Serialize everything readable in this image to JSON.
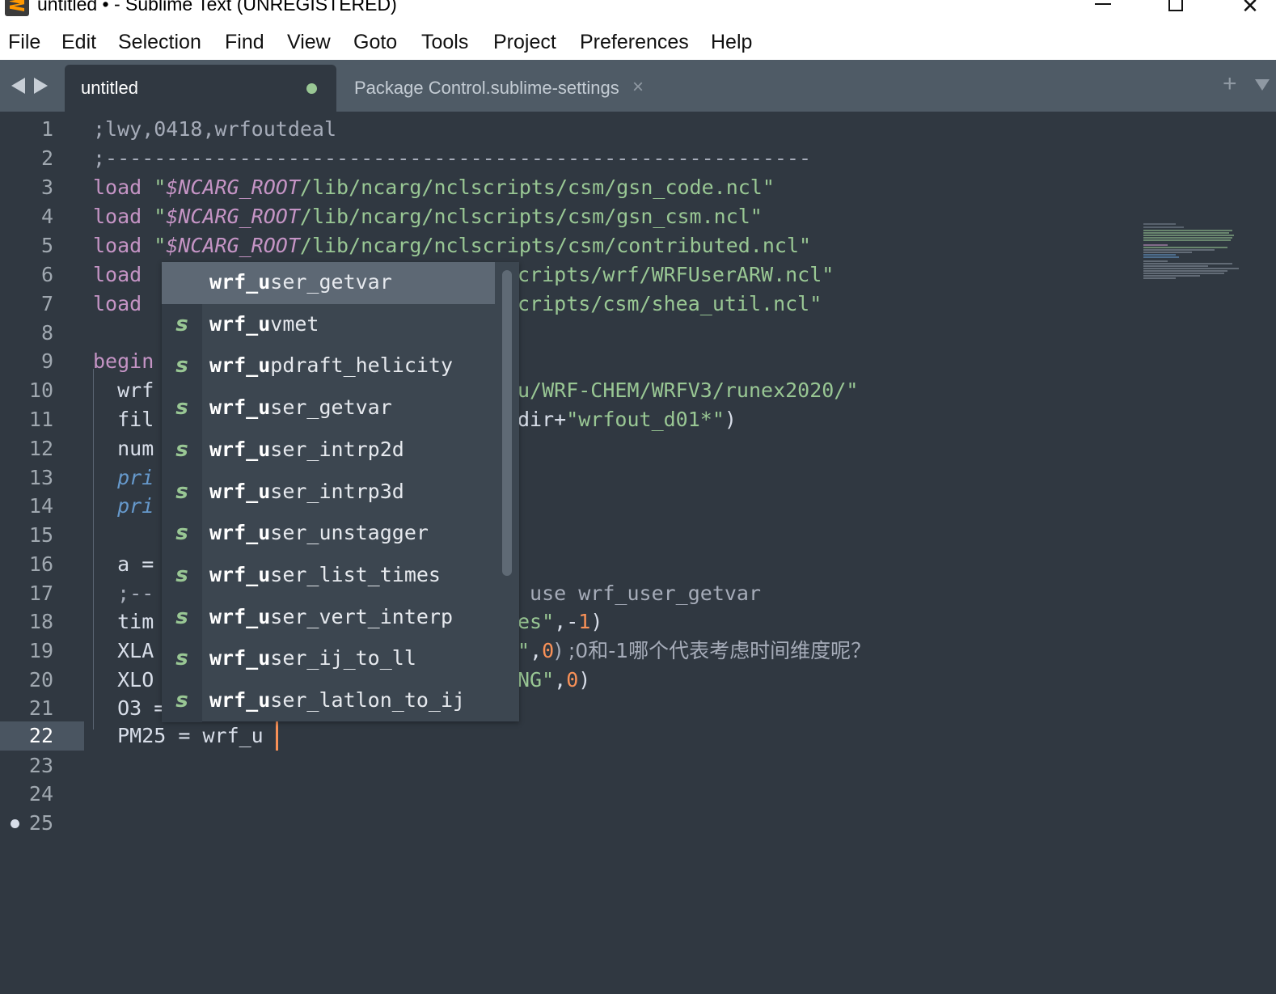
{
  "window": {
    "title": "untitled • - Sublime Text (UNREGISTERED)",
    "controls": {
      "minimize": "—",
      "close": "✕"
    }
  },
  "menu": [
    "File",
    "Edit",
    "Selection",
    "Find",
    "View",
    "Goto",
    "Tools",
    "Project",
    "Preferences",
    "Help"
  ],
  "tabs": {
    "active": {
      "label": "untitled",
      "dirty": true
    },
    "inactive": {
      "label": "Package Control.sublime-settings",
      "close": "×"
    },
    "new_tab": "+"
  },
  "gutter": {
    "line_numbers": [
      "1",
      "2",
      "3",
      "4",
      "5",
      "6",
      "7",
      "8",
      "9",
      "10",
      "11",
      "12",
      "13",
      "14",
      "15",
      "16",
      "17",
      "18",
      "19",
      "20",
      "21",
      "22",
      "23",
      "24",
      "25"
    ],
    "current_line": "22"
  },
  "code": {
    "l1": ";lwy,0418,wrfoutdeal",
    "l2": ";----------------------------------------------------------",
    "l3": {
      "kw": "load",
      "q1": " \"",
      "var": "$NCARG_ROOT",
      "path": "/lib/ncarg/nclscripts/csm/gsn_code.ncl\""
    },
    "l4": {
      "kw": "load",
      "q1": " \"",
      "var": "$NCARG_ROOT",
      "path": "/lib/ncarg/nclscripts/csm/gsn_csm.ncl\""
    },
    "l5": {
      "kw": "load",
      "q1": " \"",
      "var": "$NCARG_ROOT",
      "path": "/lib/ncarg/nclscripts/csm/contributed.ncl\""
    },
    "l6": {
      "kw": "load",
      "tail": "cripts/wrf/WRFUserARW.ncl\""
    },
    "l7": {
      "kw": "load",
      "tail": "cripts/csm/shea_util.ncl\""
    },
    "l9": "begin",
    "l10": {
      "head": "  wrf",
      "tail": "u/WRF-CHEM/WRFV3/runex2020/\""
    },
    "l11": {
      "head": "  fil",
      "tail_a": "dir+",
      "tail_b": "\"wrfout_d01*\"",
      "tail_c": ")"
    },
    "l12": "  num",
    "l13": "  pri",
    "l14": "  pri",
    "l16": "  a =",
    "l17": {
      "head": "  ;--",
      "tail": " use wrf_user_getvar"
    },
    "l18": {
      "head": "  tim",
      "tail_a": "es\"",
      "tail_b": ",-",
      "tail_c": "1",
      "tail_d": ")"
    },
    "l19": {
      "head": "  XLA",
      "tail_a": "\"",
      "tail_b": ",",
      "tail_c": "0",
      "tail_d": ") ;0和-1哪个代表考虑时间维度呢？"
    },
    "l20": {
      "head": "  XLO",
      "tail_a": "NG\"",
      "tail_b": ",",
      "tail_c": "0",
      "tail_d": ")"
    },
    "l21": "  O3 =",
    "l22": "  PM25 = wrf_u"
  },
  "autocomplete": {
    "typed": "wrf_u",
    "items": [
      {
        "kind": "",
        "label": "wrf_user_getvar",
        "selected": true
      },
      {
        "kind": "s",
        "label": "wrf_uvmet"
      },
      {
        "kind": "s",
        "label": "wrf_updraft_helicity"
      },
      {
        "kind": "s",
        "label": "wrf_user_getvar"
      },
      {
        "kind": "s",
        "label": "wrf_user_intrp2d"
      },
      {
        "kind": "s",
        "label": "wrf_user_intrp3d"
      },
      {
        "kind": "s",
        "label": "wrf_user_unstagger"
      },
      {
        "kind": "s",
        "label": "wrf_user_list_times"
      },
      {
        "kind": "s",
        "label": "wrf_user_vert_interp"
      },
      {
        "kind": "s",
        "label": "wrf_user_ij_to_ll"
      },
      {
        "kind": "s",
        "label": "wrf_user_latlon_to_ij"
      }
    ]
  },
  "colors": {
    "editor_bg": "#303841",
    "tab_bar_bg": "#4f5b66",
    "keyword": "#c594c5",
    "string": "#99c794",
    "number": "#f99157",
    "function": "#6699cc",
    "caret": "#f99157"
  }
}
